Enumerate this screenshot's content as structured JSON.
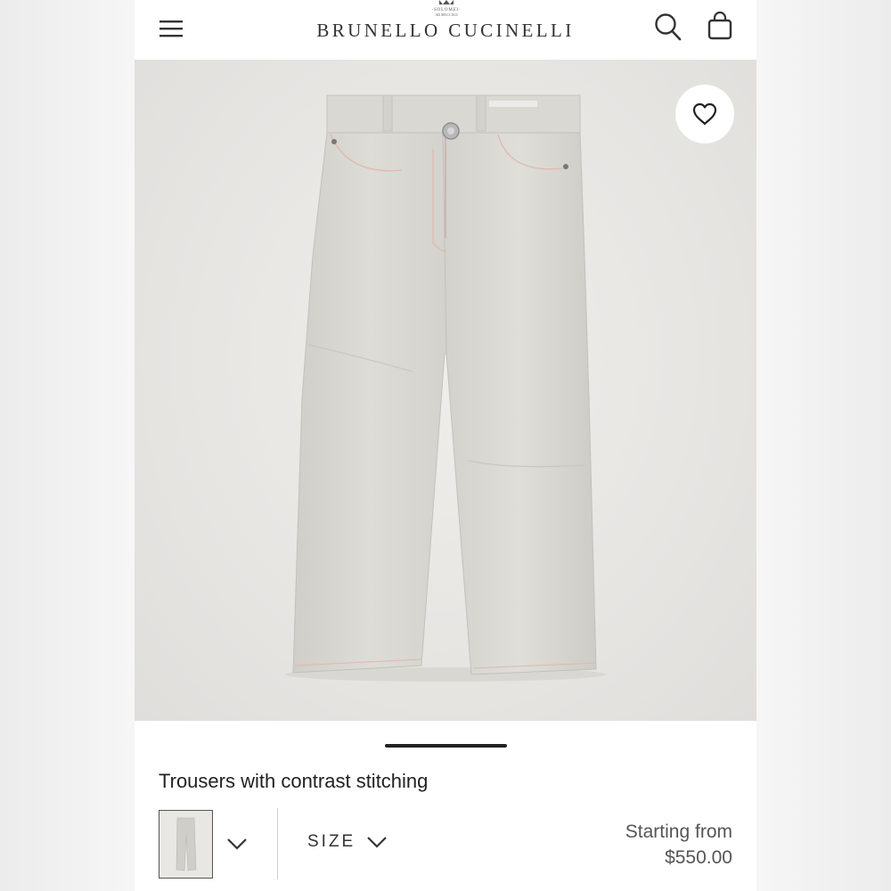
{
  "header": {
    "brand_name": "BRUNELLO CUCINELLI",
    "crest_text": "SOLOMEI · AD MCCCXCI",
    "icons": {
      "menu": "hamburger-menu-icon",
      "search": "search-icon",
      "bag": "shopping-bag-icon"
    }
  },
  "product": {
    "image_alt": "light grey five-pocket trousers",
    "wishlist_icon": "heart-outline-icon",
    "title": "Trousers with contrast stitching",
    "size_label": "SIZE",
    "price_prefix": "Starting from",
    "price": "$550.00"
  },
  "colors": {
    "fabric": "#d8d7d2",
    "stitching": "#e4b6ab",
    "background": "#e6e5e2",
    "text": "#222222"
  }
}
